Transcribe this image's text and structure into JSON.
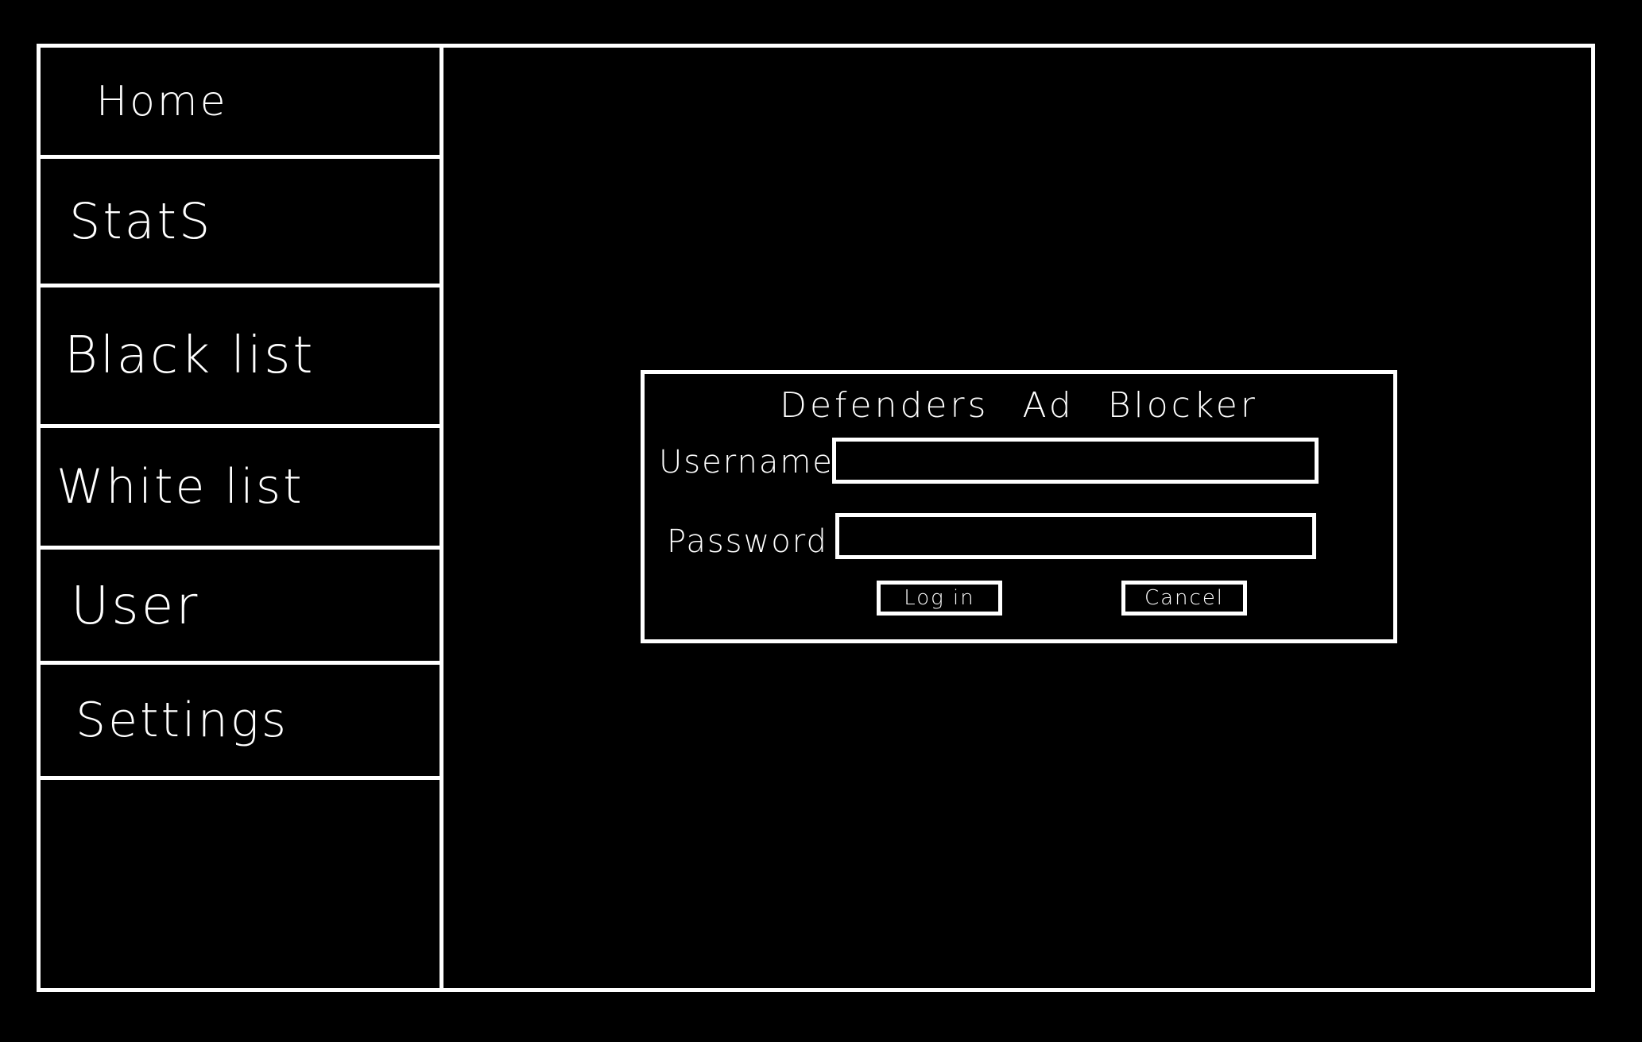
{
  "sidebar": {
    "items": [
      {
        "label": "Home"
      },
      {
        "label": "StatS"
      },
      {
        "label": "Black list"
      },
      {
        "label": "White list"
      },
      {
        "label": "User"
      },
      {
        "label": "Settings"
      }
    ]
  },
  "login_dialog": {
    "title": "Defenders Ad Blocker",
    "username_label": "Username :",
    "username_value": "",
    "password_label": "Password :",
    "password_value": "",
    "login_label": "Log in",
    "cancel_label": "Cancel"
  },
  "colors": {
    "background": "#000000",
    "foreground": "#ffffff"
  }
}
